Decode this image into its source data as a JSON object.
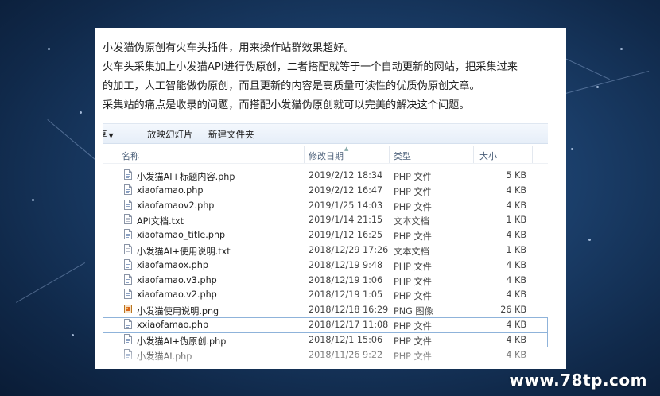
{
  "article": {
    "paragraphs": [
      "小发猫伪原创有火车头插件，用来操作站群效果超好。",
      "火车头采集加上小发猫API进行伪原创，二者搭配就等于一个自动更新的网站，把采集过来",
      "的加工，人工智能做伪原创，而且更新的内容是高质量可读性的优质伪原创文章。",
      "采集站的痛点是收录的问题，而搭配小发猫伪原创就可以完美的解决这个问题。"
    ]
  },
  "explorer": {
    "toolbar": {
      "left_label": "京享 ▾",
      "slideshow_label": "放映幻灯片",
      "new_folder_label": "新建文件夹"
    },
    "columns": {
      "name": "名称",
      "date": "修改日期",
      "type": "类型",
      "size": "大小"
    },
    "files": [
      {
        "name": "小发猫AI+标题内容.php",
        "date": "2019/2/12 18:34",
        "type": "PHP 文件",
        "size": "5 KB",
        "icon": "php-file-icon"
      },
      {
        "name": "xiaofamao.php",
        "date": "2019/2/12 16:47",
        "type": "PHP 文件",
        "size": "4 KB",
        "icon": "php-file-icon"
      },
      {
        "name": "xiaofamaov2.php",
        "date": "2019/1/25 14:03",
        "type": "PHP 文件",
        "size": "4 KB",
        "icon": "php-file-icon"
      },
      {
        "name": "API文档.txt",
        "date": "2019/1/14 21:15",
        "type": "文本文档",
        "size": "1 KB",
        "icon": "text-file-icon"
      },
      {
        "name": "xiaofamao_title.php",
        "date": "2019/1/12 16:25",
        "type": "PHP 文件",
        "size": "4 KB",
        "icon": "php-file-icon"
      },
      {
        "name": "小发猫AI+使用说明.txt",
        "date": "2018/12/29 17:26",
        "type": "文本文档",
        "size": "1 KB",
        "icon": "text-file-icon"
      },
      {
        "name": "xiaofamaox.php",
        "date": "2018/12/19 9:48",
        "type": "PHP 文件",
        "size": "4 KB",
        "icon": "php-file-icon"
      },
      {
        "name": "xiaofamao.v3.php",
        "date": "2018/12/19 1:06",
        "type": "PHP 文件",
        "size": "4 KB",
        "icon": "php-file-icon"
      },
      {
        "name": "xiaofamao.v2.php",
        "date": "2018/12/19 1:05",
        "type": "PHP 文件",
        "size": "4 KB",
        "icon": "php-file-icon"
      },
      {
        "name": "小发猫使用说明.png",
        "date": "2018/12/18 16:29",
        "type": "PNG 图像",
        "size": "26 KB",
        "icon": "png-file-icon"
      },
      {
        "name": "xxiaofamao.php",
        "date": "2018/12/17 11:08",
        "type": "PHP 文件",
        "size": "4 KB",
        "icon": "php-file-icon",
        "selected": true
      },
      {
        "name": "小发猫AI+伪原创.php",
        "date": "2018/12/1 15:06",
        "type": "PHP 文件",
        "size": "4 KB",
        "icon": "php-file-icon",
        "selected": true
      },
      {
        "name": "小发猫AI.php",
        "date": "2018/11/26 9:22",
        "type": "PHP 文件",
        "size": "4 KB",
        "icon": "php-file-icon"
      }
    ]
  },
  "watermark": "www.78tp.com"
}
